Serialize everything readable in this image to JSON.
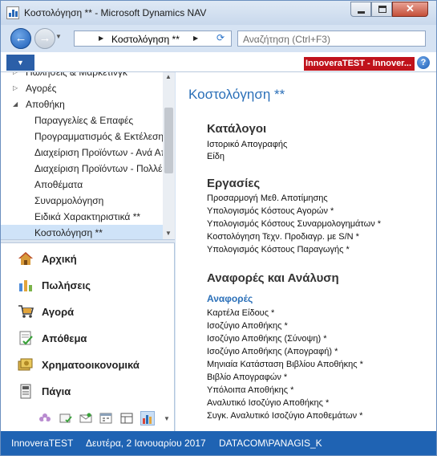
{
  "window": {
    "title": "Κοστολόγηση ** - Microsoft Dynamics NAV"
  },
  "address_bar": {
    "path": "Κοστολόγηση **",
    "search_placeholder": "Αναζήτηση (Ctrl+F3)"
  },
  "ribbon": {
    "company_badge": "InnoveraTEST - Innover..."
  },
  "nav_tree": {
    "items": [
      {
        "label": "Πωλήσεις & Μάρκετινγκ",
        "arrow": "▷"
      },
      {
        "label": "Αγορές",
        "arrow": "▷"
      },
      {
        "label": "Αποθήκη",
        "arrow": "◢"
      },
      {
        "label": "Παραγγελίες & Επαφές"
      },
      {
        "label": "Προγραμματισμός & Εκτέλεση"
      },
      {
        "label": "Διαχείριση Προϊόντων - Ανά Αποθήκη"
      },
      {
        "label": "Διαχείριση Προϊόντων - Πολλές Αποθήκες"
      },
      {
        "label": "Αποθέματα"
      },
      {
        "label": "Συναρμολόγηση"
      },
      {
        "label": "Ειδικά Χαρακτηριστικά **"
      },
      {
        "label": "Κοστολόγηση **",
        "selected": true
      }
    ]
  },
  "departments": [
    {
      "label": "Αρχική",
      "icon": "home-icon"
    },
    {
      "label": "Πωλήσεις",
      "icon": "sales-icon"
    },
    {
      "label": "Αγορά",
      "icon": "purchase-icon"
    },
    {
      "label": "Απόθεμα",
      "icon": "inventory-icon"
    },
    {
      "label": "Χρηματοοικονομικά",
      "icon": "finance-icon"
    },
    {
      "label": "Πάγια",
      "icon": "fixed-assets-icon"
    }
  ],
  "bottom_icons": [
    "flower-icon",
    "folder-check-icon",
    "mail-icon",
    "calendar-icon",
    "table-icon",
    "chart-icon"
  ],
  "content": {
    "page_title": "Κοστολόγηση **",
    "sections": [
      {
        "heading": "Κατάλογοι",
        "links": [
          "Ιστορικό Απογραφής",
          "Είδη"
        ]
      },
      {
        "heading": "Εργασίες",
        "links": [
          "Προσαρμογή Μεθ. Αποτίμησης",
          "Υπολογισμός Κόστους Αγορών *",
          "Υπολογισμός Κόστους Συναρμολογημάτων *",
          "Κοστολόγηση Τεχν. Προδιαγρ. με S/N *",
          "Υπολογισμός Κόστους Παραγωγής *"
        ]
      },
      {
        "heading": "Αναφορές και Ανάλυση",
        "subheading": "Αναφορές",
        "links": [
          "Καρτέλα Είδους *",
          "Ισοζύγιο Αποθήκης *",
          "Ισοζύγιο Αποθήκης (Σύνοψη) *",
          "Ισοζύγιο Αποθήκης (Απογραφή) *",
          "Μηνιαία Κατάσταση Βιβλίου Αποθήκης *",
          "Βιβλίο Απογραφών *",
          "Υπόλοιπα Αποθήκης *",
          "Αναλυτικό Ισοζύγιο Αποθήκης *",
          "Συγκ. Αναλυτικό Ισοζύγιο Αποθεμάτων *"
        ]
      }
    ]
  },
  "status_bar": {
    "company": "InnoveraTEST",
    "date": "Δευτέρα, 2 Ιανουαρίου 2017",
    "user": "DATACOM\\PANAGIS_K"
  },
  "colors": {
    "accent": "#2a6fb8",
    "status_bar": "#1f63b3",
    "company_badge": "#c0121b",
    "selection": "#cfe3f8"
  }
}
